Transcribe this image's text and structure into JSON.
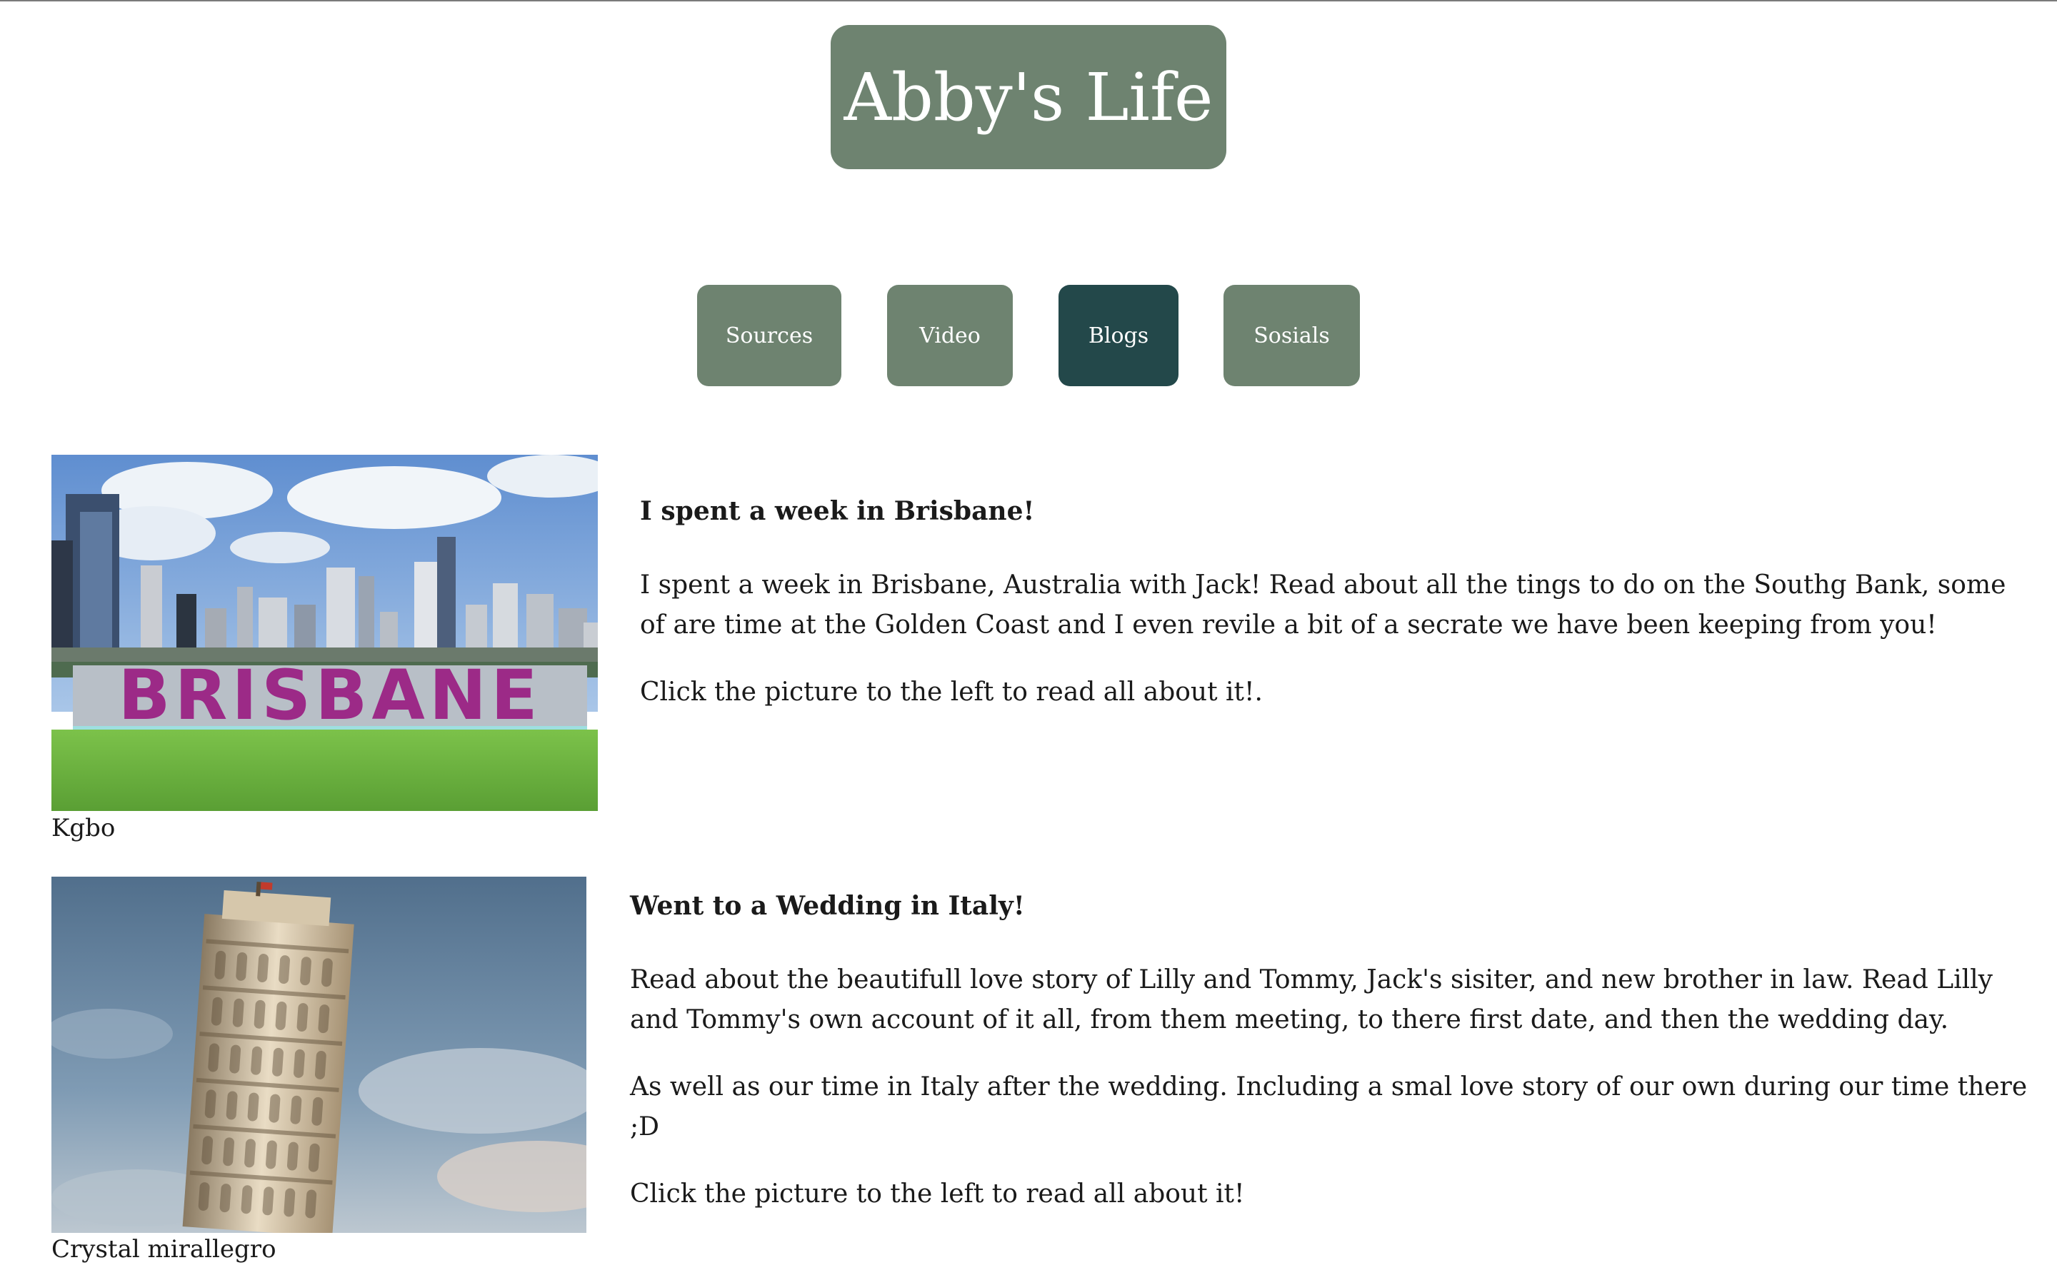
{
  "site": {
    "title": "Abby's Life"
  },
  "nav": {
    "items": [
      {
        "label": "Sources",
        "active": false
      },
      {
        "label": "Video",
        "active": false
      },
      {
        "label": "Blogs",
        "active": true
      },
      {
        "label": "Sosials",
        "active": false
      }
    ]
  },
  "posts": [
    {
      "heading": "I spent a week in Brisbane!",
      "paragraphs": [
        "I spent a week in Brisbane, Australia with Jack! Read about all the tings to do on the Southg Bank, some of are time at the Golden Coast and I even revile a bit of a secrate we have been keeping from you!",
        "Click the picture to the left to read all about it!."
      ],
      "photo_credit": "Kgbo",
      "photo_text": "BRISBANE"
    },
    {
      "heading": "Went to a Wedding in Italy!",
      "paragraphs": [
        "Read about the beautifull love story of Lilly and Tommy, Jack's sisiter, and new brother in law. Read Lilly and Tommy's own account of it all, from them meeting, to there first date, and then the wedding day.",
        "As well as our time in Italy after the wedding. Including a smal love story of our own during our time there ;D",
        "Click the picture to the left to read all about it!"
      ],
      "photo_credit": "Crystal mirallegro"
    }
  ],
  "colors": {
    "accent": "#6e8370",
    "active": "#23484a",
    "text": "#1a1a1a",
    "background": "#ffffff"
  }
}
